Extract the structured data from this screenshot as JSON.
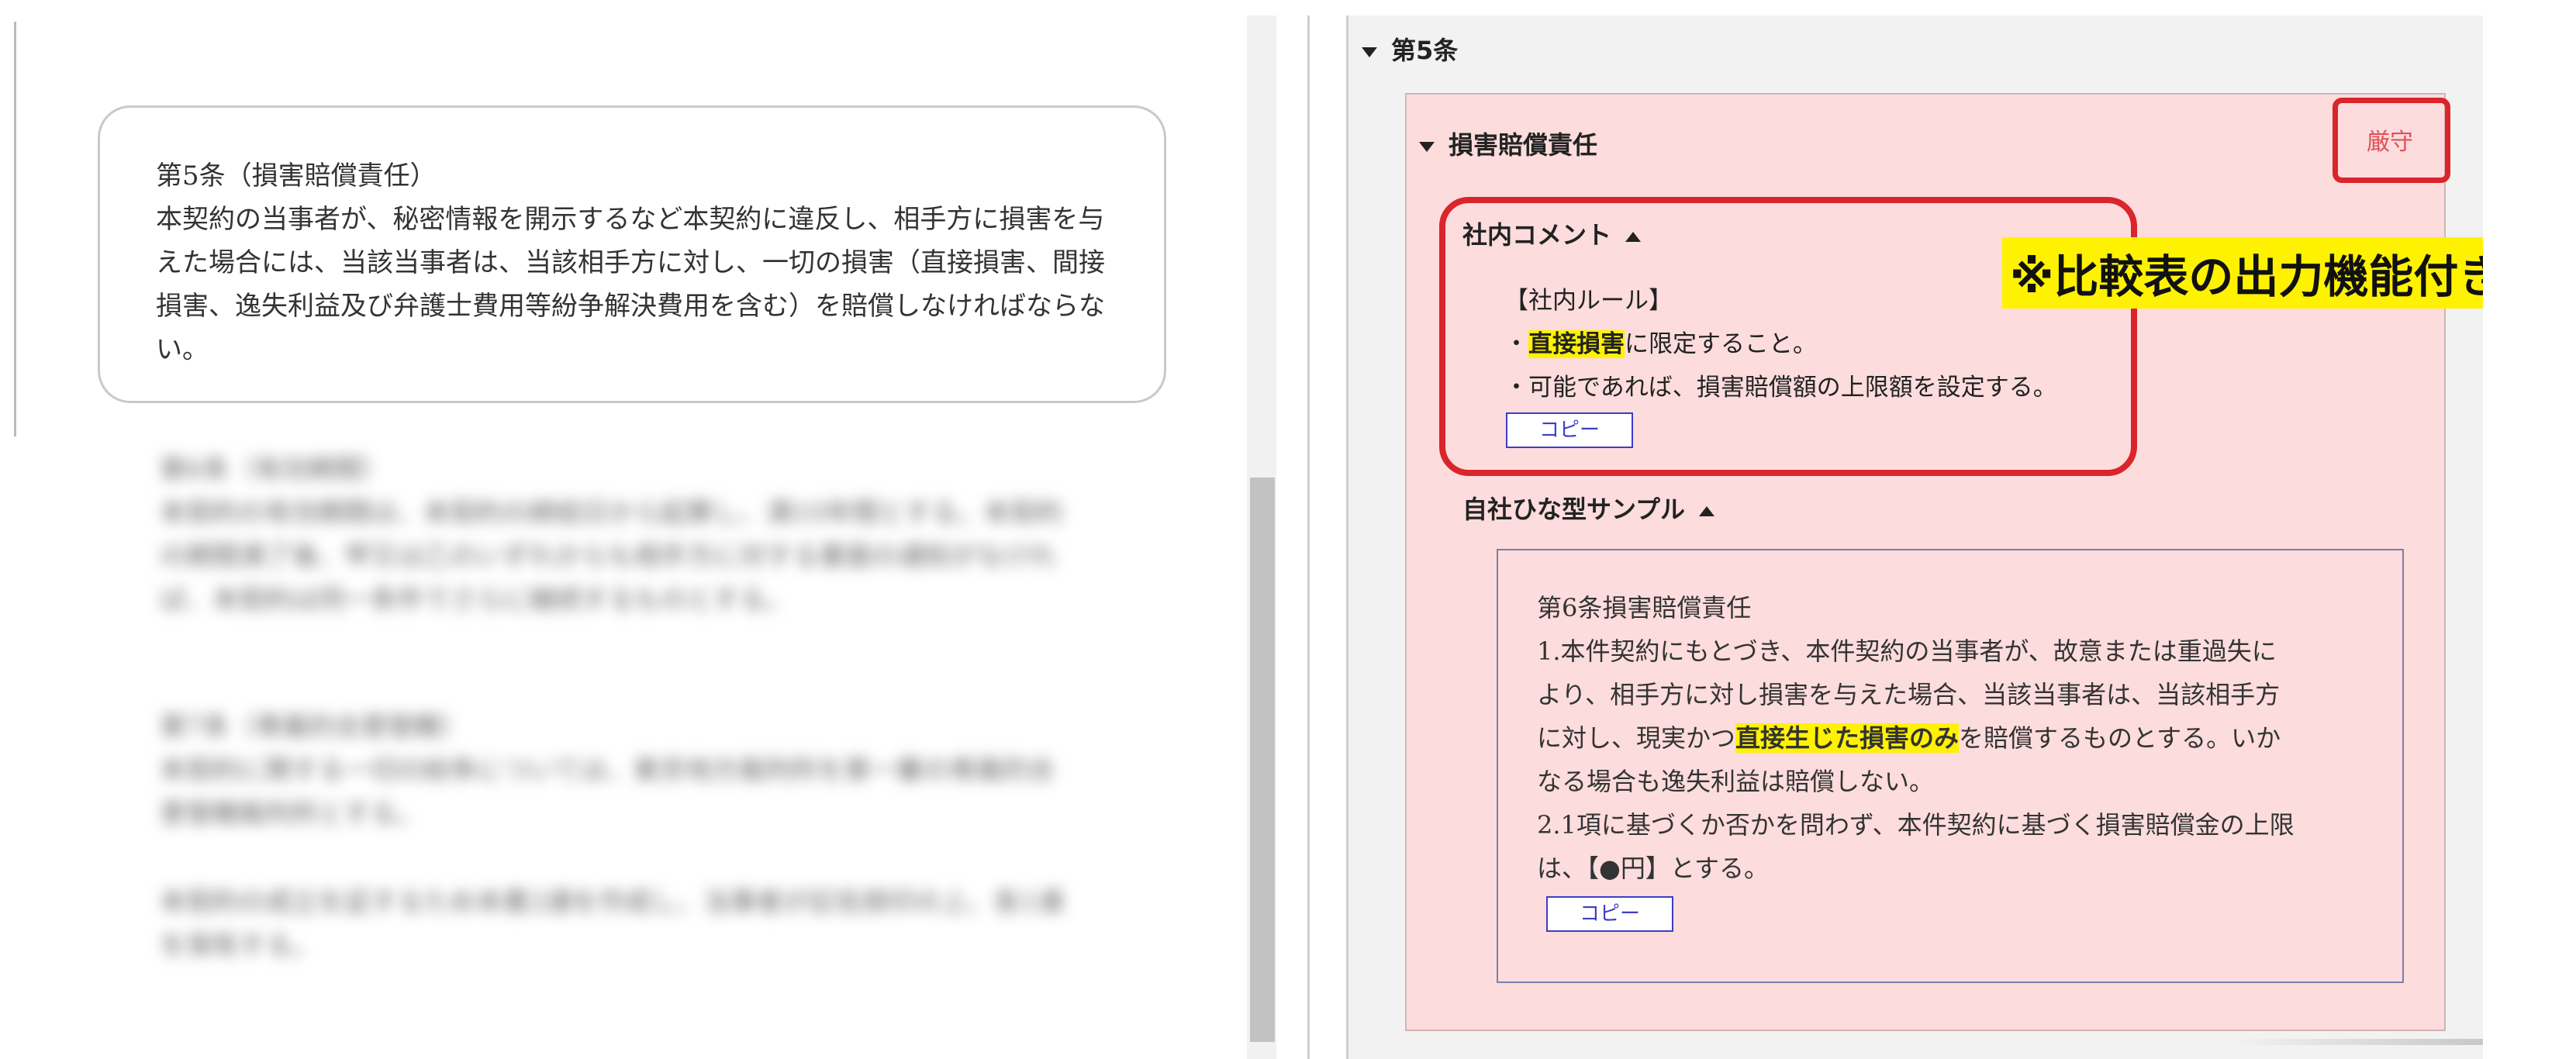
{
  "document": {
    "article5": {
      "title": "第5条（損害賠償責任）",
      "body": "本契約の当事者が、秘密情報を開示するなど本契約に違反し、相手方に損害を与えた場合には、当該当事者は、当該相手方に対し、一切の損害（直接損害、間接損害、逸失利益及び弁護士費用等紛争解決費用を含む）を賠償しなければならない。"
    },
    "article6": {
      "title": "第6条（有効期間）",
      "lines": [
        "本契約の有効期間は、本契約の締結日から起算し、満10年間とする。本契約",
        "の期間満了後、甲又は乙のいずれからも相手方に対する書面の通知がなけれ",
        "ば、本契約は同一条件でさらに継続するものとする。"
      ]
    },
    "article7": {
      "title": "第7条（専属的合意管轄）",
      "lines": [
        "本契約に関する一切の紛争については、東京地方裁判所を第一審の専属的合",
        "意管轄裁判所とする。"
      ]
    },
    "closing": {
      "lines": [
        "本契約の成立を証するため本書2通を作成し、当事者が記名捺印の上、各1通",
        "を保有する。"
      ]
    }
  },
  "panel": {
    "article_heading": "第5条",
    "clause_heading": "損害賠償責任",
    "strict_badge": "厳守",
    "feature_note": "※比較表の出力機能付き",
    "comment": {
      "heading": "社内コメント",
      "rule_title": "【社内ルール】",
      "rule1_prefix": "・",
      "rule1_highlight": "直接損害",
      "rule1_suffix": "に限定すること。",
      "rule2": "・可能であれば、損害賠償額の上限額を設定する。",
      "copy_label": "コピー"
    },
    "sample": {
      "heading": "自社ひな型サンプル",
      "title": "第6条損害賠償責任",
      "line1": "1.本件契約にもとづき、本件契約の当事者が、故意または重過失に",
      "line2": "より、相手方に対し損害を与えた場合、当該当事者は、当該相手方",
      "line3_prefix": "に対し、現実かつ",
      "line3_highlight": "直接生じた損害のみ",
      "line3_suffix": "を賠償するものとする。いか",
      "line4": "なる場合も逸失利益は賠償しない。",
      "line5": "2.1項に基づくか否かを問わず、本件契約に基づく損害賠償金の上限",
      "line6": "は、【●円】とする。",
      "copy_label": "コピー"
    }
  },
  "colors": {
    "clause_background": "#fcdcdc",
    "highlight": "#fff200",
    "emphasis_border": "#d9252b",
    "copy_button": "#3d3dc7"
  }
}
